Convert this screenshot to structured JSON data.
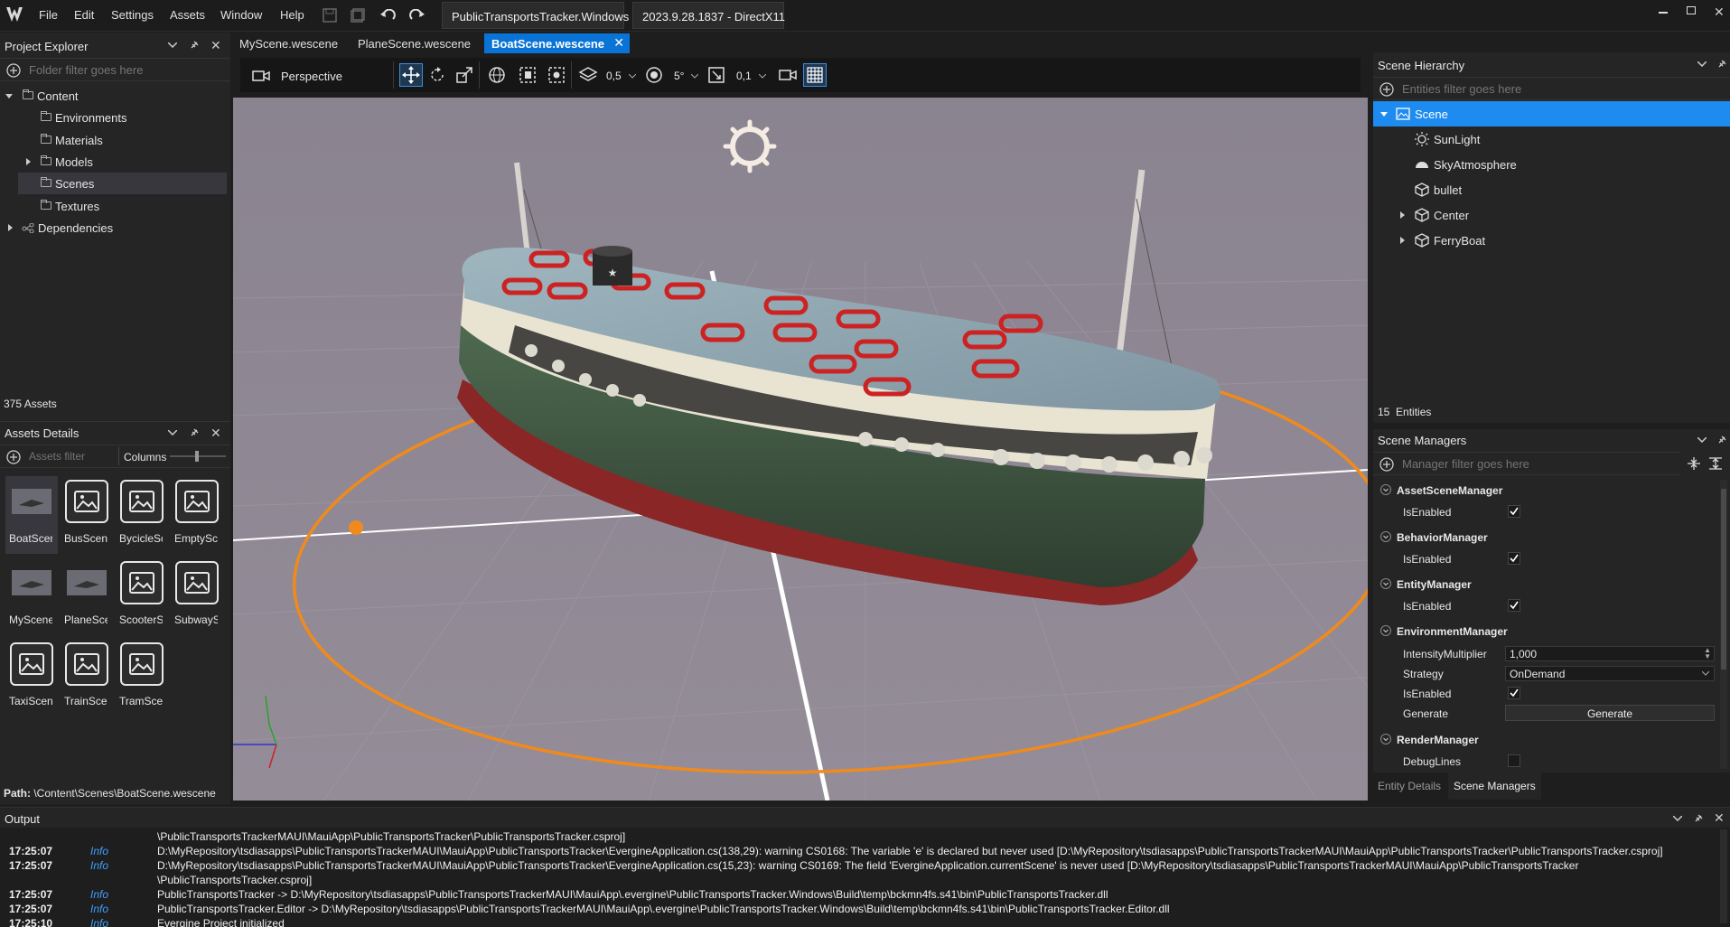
{
  "titlebar": {
    "menus": [
      "File",
      "Edit",
      "Settings",
      "Assets",
      "Window",
      "Help"
    ],
    "project": "PublicTransportsTracker.Windows",
    "version": "2023.9.28.1837 - DirectX11"
  },
  "project_explorer": {
    "title": "Project Explorer",
    "filter_placeholder": "Folder filter goes here",
    "tree": {
      "content": "Content",
      "environments": "Environments",
      "materials": "Materials",
      "models": "Models",
      "scenes": "Scenes",
      "textures": "Textures",
      "dependencies": "Dependencies"
    },
    "asset_count": "375 Assets"
  },
  "assets_details": {
    "title": "Assets Details",
    "filter_placeholder": "Assets filter",
    "columns_label": "Columns",
    "items": [
      "BoatScen",
      "BusScene",
      "BycicleSc",
      "EmptySce",
      "MyScene.",
      "PlaneSce",
      "ScooterSc",
      "SubwaySc",
      "TaxiScene",
      "TrainScer",
      "TramScer"
    ],
    "path_label": "Path:",
    "path_value": "\\Content\\Scenes\\BoatScene.wescene"
  },
  "tabs": [
    "MyScene.wescene",
    "PlaneScene.wescene",
    "BoatScene.wescene"
  ],
  "viewport_toolbar": {
    "camera_mode": "Perspective",
    "snap_translate": "0,5",
    "snap_rotate": "5°",
    "snap_scale": "0,1"
  },
  "scene_hierarchy": {
    "title": "Scene Hierarchy",
    "filter_placeholder": "Entities filter goes here",
    "root": "Scene",
    "entities": [
      "SunLight",
      "SkyAtmosphere",
      "bullet",
      "Center",
      "FerryBoat"
    ],
    "count": "15",
    "count_label": "Entities"
  },
  "scene_managers": {
    "title": "Scene Managers",
    "filter_placeholder": "Manager filter goes here",
    "asset_scene_manager": "AssetSceneManager",
    "behavior_manager": "BehaviorManager",
    "entity_manager": "EntityManager",
    "environment_manager": "EnvironmentManager",
    "render_manager": "RenderManager",
    "is_enabled": "IsEnabled",
    "intensity_label": "IntensityMultiplier",
    "intensity_value": "1,000",
    "strategy_label": "Strategy",
    "strategy_value": "OnDemand",
    "generate_label": "Generate",
    "generate_button": "Generate",
    "debug_lines": "DebugLines"
  },
  "bottom_tabs": [
    "Entity Details",
    "Scene Managers"
  ],
  "output": {
    "title": "Output",
    "lines": [
      {
        "time": "",
        "level": "",
        "msg": "\\PublicTransportsTrackerMAUI\\MauiApp\\PublicTransportsTracker\\PublicTransportsTracker.csproj]"
      },
      {
        "time": "17:25:07",
        "level": "Info",
        "msg": "D:\\MyRepository\\tsdiasapps\\PublicTransportsTrackerMAUI\\MauiApp\\PublicTransportsTracker\\EvergineApplication.cs(138,29): warning CS0168: The variable 'e' is declared but never used [D:\\MyRepository\\tsdiasapps\\PublicTransportsTrackerMAUI\\MauiApp\\PublicTransportsTracker\\PublicTransportsTracker.csproj]"
      },
      {
        "time": "17:25:07",
        "level": "Info",
        "msg": "D:\\MyRepository\\tsdiasapps\\PublicTransportsTrackerMAUI\\MauiApp\\PublicTransportsTracker\\EvergineApplication.cs(15,23): warning CS0169: The field 'EvergineApplication.currentScene' is never used [D:\\MyRepository\\tsdiasapps\\PublicTransportsTrackerMAUI\\MauiApp\\PublicTransportsTracker"
      },
      {
        "time": "",
        "level": "",
        "msg": "\\PublicTransportsTracker.csproj]"
      },
      {
        "time": "17:25:07",
        "level": "Info",
        "msg": "  PublicTransportsTracker -> D:\\MyRepository\\tsdiasapps\\PublicTransportsTrackerMAUI\\MauiApp\\.evergine\\PublicTransportsTracker.Windows\\Build\\temp\\bckmn4fs.s41\\bin\\PublicTransportsTracker.dll"
      },
      {
        "time": "17:25:07",
        "level": "Info",
        "msg": "  PublicTransportsTracker.Editor -> D:\\MyRepository\\tsdiasapps\\PublicTransportsTrackerMAUI\\MauiApp\\.evergine\\PublicTransportsTracker.Windows\\Build\\temp\\bckmn4fs.s41\\bin\\PublicTransportsTracker.Editor.dll"
      },
      {
        "time": "17:25:10",
        "level": "Info",
        "msg": "Evergine Project initialized"
      }
    ]
  },
  "colors": {
    "accent": "#0a74d6",
    "selection": "#1e8bf0",
    "viewport": "#8c8592",
    "orbit": "#f08a1c"
  }
}
